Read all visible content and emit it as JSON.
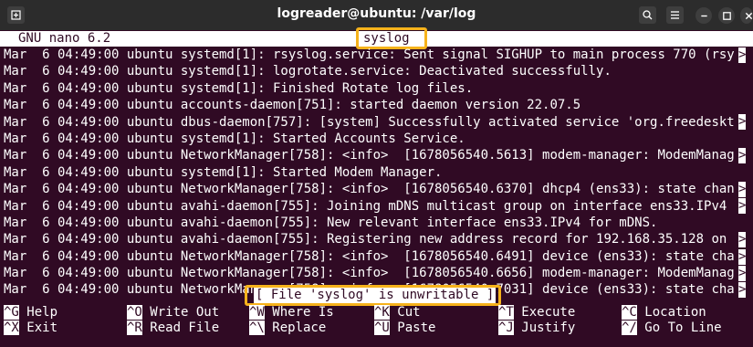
{
  "window": {
    "title": "logreader@ubuntu: /var/log"
  },
  "nano": {
    "version": "GNU nano 6.2",
    "filename": "syslog",
    "status_message": "[ File 'syslog' is unwritable ]"
  },
  "log_lines": [
    "Mar  6 04:49:00 ubuntu systemd[1]: rsyslog.service: Sent signal SIGHUP to main process 770 (rsy",
    "Mar  6 04:49:00 ubuntu systemd[1]: logrotate.service: Deactivated successfully.",
    "Mar  6 04:49:00 ubuntu systemd[1]: Finished Rotate log files.",
    "Mar  6 04:49:00 ubuntu accounts-daemon[751]: started daemon version 22.07.5",
    "Mar  6 04:49:00 ubuntu dbus-daemon[757]: [system] Successfully activated service 'org.freedeskt",
    "Mar  6 04:49:00 ubuntu systemd[1]: Started Accounts Service.",
    "Mar  6 04:49:00 ubuntu NetworkManager[758]: <info>  [1678056540.5613] modem-manager: ModemManag",
    "Mar  6 04:49:00 ubuntu systemd[1]: Started Modem Manager.",
    "Mar  6 04:49:00 ubuntu NetworkManager[758]: <info>  [1678056540.6370] dhcp4 (ens33): state chan",
    "Mar  6 04:49:00 ubuntu avahi-daemon[755]: Joining mDNS multicast group on interface ens33.IPv4 ",
    "Mar  6 04:49:00 ubuntu avahi-daemon[755]: New relevant interface ens33.IPv4 for mDNS.",
    "Mar  6 04:49:00 ubuntu avahi-daemon[755]: Registering new address record for 192.168.35.128 on ",
    "Mar  6 04:49:00 ubuntu NetworkManager[758]: <info>  [1678056540.6491] device (ens33): state cha",
    "Mar  6 04:49:00 ubuntu NetworkManager[758]: <info>  [1678056540.6656] modem-manager: ModemManag",
    "Mar  6 04:49:00 ubuntu NetworkManager[758]: <info>  [1678056540.7031] device (ens33): state cha"
  ],
  "shortcuts_row1": [
    {
      "key": "^G",
      "label": "Help"
    },
    {
      "key": "^O",
      "label": "Write Out"
    },
    {
      "key": "^W",
      "label": "Where Is"
    },
    {
      "key": "^K",
      "label": "Cut"
    },
    {
      "key": "^T",
      "label": "Execute"
    },
    {
      "key": "^C",
      "label": "Location"
    }
  ],
  "shortcuts_row2": [
    {
      "key": "^X",
      "label": "Exit"
    },
    {
      "key": "^R",
      "label": "Read File"
    },
    {
      "key": "^\\",
      "label": "Replace"
    },
    {
      "key": "^U",
      "label": "Paste"
    },
    {
      "key": "^J",
      "label": "Justify"
    },
    {
      "key": "^/",
      "label": "Go To Line"
    }
  ],
  "icons": {
    "new_tab": "new-tab-icon",
    "search": "search-icon",
    "menu": "hamburger-menu-icon",
    "minimize": "minimize-icon",
    "maximize": "maximize-icon",
    "close": "close-icon"
  },
  "colors": {
    "terminal_bg": "#300a24",
    "highlight": "#f6b21b",
    "titlebar_bg": "#2c2c2c"
  }
}
